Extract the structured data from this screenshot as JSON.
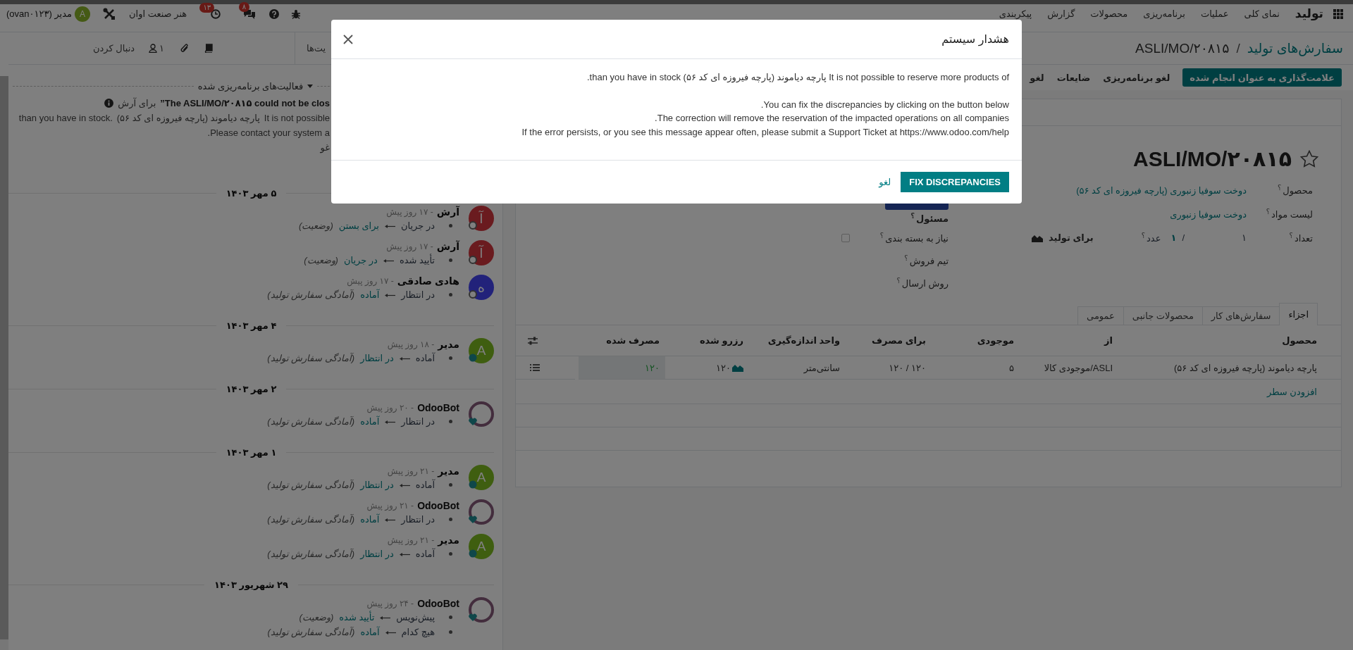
{
  "navbar": {
    "app": "تولید",
    "menu": [
      "نمای کلی",
      "عملیات",
      "برنامه‌ریزی",
      "محصولات",
      "گزارش",
      "پیکربندی"
    ],
    "chat_badge": "۸",
    "activity_badge": "۱۳",
    "company": "هنر صنعت اوان",
    "user": {
      "initial": "A",
      "name": "مدیر (ovan۰۱۲۳)"
    }
  },
  "chatter_bar": {
    "activities": "یت‌ها",
    "followers": "۱",
    "follow": "دنبال کردن"
  },
  "breadcrumb": {
    "parent": "سفارش‌های تولید",
    "separator": "/",
    "current": "ASLI/MO/۲۰۸۱۵"
  },
  "actions": [
    {
      "label": "علامت‌گذاری به عنوان انجام شده",
      "kind": "primary"
    },
    {
      "label": "لغو برنامه‌ریزی",
      "kind": "secondary"
    },
    {
      "label": "ضایعات",
      "kind": "secondary"
    },
    {
      "label": "لغو",
      "kind": "secondary"
    }
  ],
  "chatter": {
    "activities_toggle": {
      "label": "فعالیت‌های برنامه‌ریزی شده",
      "expanded": true
    },
    "notice": {
      "title": "”The ASLI/MO/۲۰۸۱۵ could not be clos",
      "recipient": "برای آرش",
      "line_2": [
        "It is not possible",
        "پارچه دیاموند (پارچه فیروزه ای کد ۵۶)",
        "than you have in stock."
      ],
      "line_3": ".Please contact your system a",
      "action": "غو"
    },
    "timeline": [
      {
        "date": "۵ مهر ۱۴۰۳",
        "messages": [
          {
            "author": "آرش",
            "time": "- ۱۷ روز پیش",
            "avatar": {
              "kind": "letter",
              "initial": "آ",
              "color": "#6a1b1f",
              "online": false
            },
            "changes": [
              {
                "from": "در جریان",
                "to": "برای بستن",
                "field": "(وضعیت)"
              }
            ]
          },
          {
            "author": "آرش",
            "time": "- ۱۷ روز پیش",
            "avatar": {
              "kind": "letter",
              "initial": "آ",
              "color": "#6a1b1f",
              "online": false
            },
            "changes": [
              {
                "from": "تأیید شده",
                "to": "در جریان",
                "field": "(وضعیت)"
              }
            ]
          },
          {
            "author": "هادی صادقی",
            "time": "- ۱۷ روز پیش",
            "avatar": {
              "kind": "letter",
              "initial": "ه",
              "color": "#22227a",
              "online": false
            },
            "changes": [
              {
                "from": "در انتظار",
                "to": "آماده",
                "field": "(آمادگی سفارش تولید)"
              }
            ]
          }
        ]
      },
      {
        "date": "۴ مهر ۱۴۰۳",
        "messages": [
          {
            "author": "مدیر",
            "time": "- ۱۸ روز پیش",
            "avatar": {
              "kind": "letter",
              "initial": "A",
              "color": "#3f5e10",
              "online": true
            },
            "changes": [
              {
                "from": "آماده",
                "to": "در انتظار",
                "field": "(آمادگی سفارش تولید)"
              }
            ]
          }
        ]
      },
      {
        "date": "۲ مهر ۱۴۰۳",
        "messages": [
          {
            "author": "OdooBot",
            "time": "- ۲۰ روز پیش",
            "avatar": {
              "kind": "bot"
            },
            "changes": [
              {
                "from": "در انتظار",
                "to": "آماده",
                "field": "(آمادگی سفارش تولید)"
              }
            ]
          }
        ]
      },
      {
        "date": "۱ مهر ۱۴۰۳",
        "messages": [
          {
            "author": "مدیر",
            "time": "- ۲۱ روز پیش",
            "avatar": {
              "kind": "letter",
              "initial": "A",
              "color": "#3f5e10",
              "online": true
            },
            "changes": [
              {
                "from": "آماده",
                "to": "در انتظار",
                "field": "(آمادگی سفارش تولید)"
              }
            ]
          },
          {
            "author": "OdooBot",
            "time": "- ۲۱ روز پیش",
            "avatar": {
              "kind": "bot"
            },
            "changes": [
              {
                "from": "در انتظار",
                "to": "آماده",
                "field": "(آمادگی سفارش تولید)"
              }
            ]
          },
          {
            "author": "مدیر",
            "time": "- ۲۱ روز پیش",
            "avatar": {
              "kind": "letter",
              "initial": "A",
              "color": "#3f5e10",
              "online": true
            },
            "changes": [
              {
                "from": "آماده",
                "to": "در انتظار",
                "field": "(آمادگی سفارش تولید)"
              }
            ]
          }
        ]
      },
      {
        "date": "۲۹ شهریور ۱۴۰۳",
        "messages": [
          {
            "author": "OdooBot",
            "time": "- ۲۴ روز پیش",
            "avatar": {
              "kind": "bot"
            },
            "changes": [
              {
                "from": "پیش‌نویس",
                "to": "تأیید شده",
                "field": "(وضعیت)"
              },
              {
                "from": "هیچ کدام",
                "to": "آماده",
                "field": "(آمادگی سفارش تولید)"
              }
            ]
          }
        ]
      }
    ]
  },
  "form": {
    "title": "ASLI/MO/۲۰۸۱۵",
    "starred": false,
    "fields_right": [
      {
        "kind": "link",
        "label": "محصول",
        "hint": "؟",
        "value": "دوخت سوفیا زنبوری (پارچه فیروزه ای کد ۵۶)"
      },
      {
        "kind": "link",
        "label": "لیست مواد",
        "hint": "؟",
        "value": "دوخت سوفیا زنبوری"
      },
      {
        "kind": "quantity",
        "label": "تعداد",
        "hint": "؟",
        "quantity": "۱",
        "separator": "/",
        "produced": "۱",
        "unit": "عدد",
        "unit_hint": "؟",
        "forecast": "برای تولید"
      }
    ],
    "fields_left": [
      {
        "kind": "required",
        "label": "مسئول",
        "hint": "؟"
      },
      {
        "kind": "checkbox",
        "label": "نیاز به بسته بندی",
        "hint": "؟",
        "checked": false
      },
      {
        "kind": "text",
        "label": "تیم فروش",
        "hint": "؟"
      },
      {
        "kind": "text",
        "label": "روش ارسال",
        "hint": "؟"
      }
    ],
    "tabs": [
      {
        "label": "اجزاء",
        "selected": true
      },
      {
        "label": "سفارش‌های کار",
        "selected": false
      },
      {
        "label": "محصولات جانبی",
        "selected": false
      },
      {
        "label": "عمومی",
        "selected": false
      }
    ],
    "table": {
      "columns": [
        "محصول",
        "از",
        "موجودی",
        "برای مصرف",
        "واحد اندازه‌گیری",
        "رزرو شده",
        "مصرف شده"
      ],
      "rows": [
        {
          "product": "پارچه دیاموند (پارچه فیروزه ای کد ۵۶)",
          "from": "ASLI/موجودی کالا",
          "on_hand": "۵",
          "to_consume": "۱۲۰ / ۱۲۰",
          "uom": "سانتی‌متر",
          "reserved": "۱۲۰",
          "consumed": "۱۲۰"
        }
      ],
      "add_line": "افزودن سطر"
    }
  },
  "dialog": {
    "title": "هشدار سیستم",
    "paragraphs": [
      "It is not possible to reserve more products of پارچه دیاموند (پارچه فیروزه ای کد ۵۶) than you have in stock.",
      "You can fix the discrepancies by clicking on the button below.",
      "The correction will remove the reservation of the impacted operations on all companies.",
      "If the error persists, or you see this message appear often, please submit a Support Ticket at https://www.odoo.com/help"
    ],
    "buttons": [
      {
        "label": "FIX DISCREPANCIES",
        "kind": "primary"
      },
      {
        "label": "لغو",
        "kind": "link"
      }
    ]
  }
}
